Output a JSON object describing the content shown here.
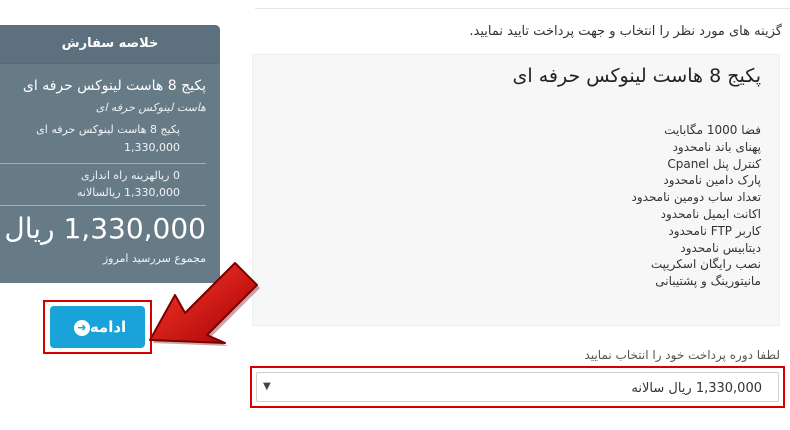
{
  "instructions": "گزینه های مورد نظر را انتخاب و جهت پرداخت تایید نمایید.",
  "product": {
    "title": "پکیج 8 هاست لینوکس حرفه ای",
    "features": [
      "فضا 1000 مگابایت",
      "پهنای باند نامحدود",
      "کنترل پنل Cpanel",
      "پارک دامین نامحدود",
      "تعداد ساب دومین نامحدود",
      "اکانت ایمیل نامحدود",
      "کاربر FTP نامحدود",
      "دیتابیس نامحدود",
      "نصب رایگان اسکریپت",
      "مانیتورینگ و پشتیبانی"
    ]
  },
  "billing": {
    "label": "لطفا دوره پرداخت خود را انتخاب نمایید",
    "selected": "1,330,000 ریال سالانه"
  },
  "summary": {
    "header": "خلاصه سفارش",
    "product_name": "پکیج 8 هاست لینوکس حرفه ای",
    "product_group": "هاست لینوکس حرفه ای",
    "line_item_name": "پکیج 8 هاست لینوکس حرفه ای",
    "line_item_price": "1,330,000",
    "setup_fee": "0 ریالهزینه راه اندازی",
    "annual": "1,330,000 ریالسالانه",
    "total": "1,330,000 ریال",
    "total_label": "مجموع سررسید امروز"
  },
  "continue_button": "ادامه",
  "colors": {
    "summary_bg": "#677b86",
    "button": "#1aa3d9",
    "highlight": "#d40000"
  }
}
